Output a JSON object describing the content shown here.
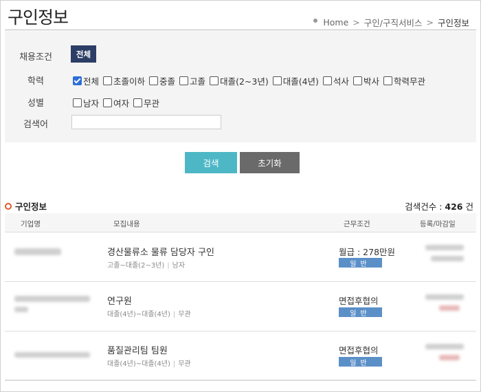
{
  "header": {
    "title": "구인정보",
    "breadcrumb": {
      "home": "Home",
      "sep1": ">",
      "mid": "구인/구직서비스",
      "sep2": ">",
      "current": "구인정보"
    }
  },
  "filters": {
    "employment": {
      "label": "채용조건",
      "button": "전체"
    },
    "education": {
      "label": "학력",
      "options": [
        {
          "label": "전체",
          "checked": true
        },
        {
          "label": "초졸이하",
          "checked": false
        },
        {
          "label": "중졸",
          "checked": false
        },
        {
          "label": "고졸",
          "checked": false
        },
        {
          "label": "대졸(2~3년)",
          "checked": false
        },
        {
          "label": "대졸(4년)",
          "checked": false
        },
        {
          "label": "석사",
          "checked": false
        },
        {
          "label": "박사",
          "checked": false
        },
        {
          "label": "학력무관",
          "checked": false
        }
      ]
    },
    "gender": {
      "label": "성별",
      "options": [
        {
          "label": "남자",
          "checked": false
        },
        {
          "label": "여자",
          "checked": false
        },
        {
          "label": "무관",
          "checked": false
        }
      ]
    },
    "keyword": {
      "label": "검색어",
      "value": ""
    }
  },
  "actions": {
    "search": "검색",
    "reset": "초기화"
  },
  "results": {
    "heading": "구인정보",
    "count_label": "검색건수 :",
    "count": "426",
    "count_unit": "건",
    "columns": {
      "company": "기업명",
      "content": "모집내용",
      "conditions": "근무조건",
      "dates": "등록/마감일"
    },
    "rows": [
      {
        "title": "경산물류소 물류 담당자 구인",
        "edu": "고졸~대졸(2~3년)",
        "gender": "남자",
        "salary": "월급 : 278만원",
        "type": "일반"
      },
      {
        "title": "연구원",
        "edu": "대졸(4년)~대졸(4년)",
        "gender": "무관",
        "salary": "면접후협의",
        "type": "일반"
      },
      {
        "title": "품질관리팀 팀원",
        "edu": "대졸(4년)~대졸(4년)",
        "gender": "무관",
        "salary": "면접후협의",
        "type": "일반"
      }
    ]
  },
  "colors": {
    "navy_button": "#2c3e66",
    "search_button": "#4eb7c6",
    "reset_button": "#6a6a6a",
    "badge": "#5b8fc8",
    "bullet": "#e05a2b",
    "checkbox_checked": "#2d6fd6"
  }
}
